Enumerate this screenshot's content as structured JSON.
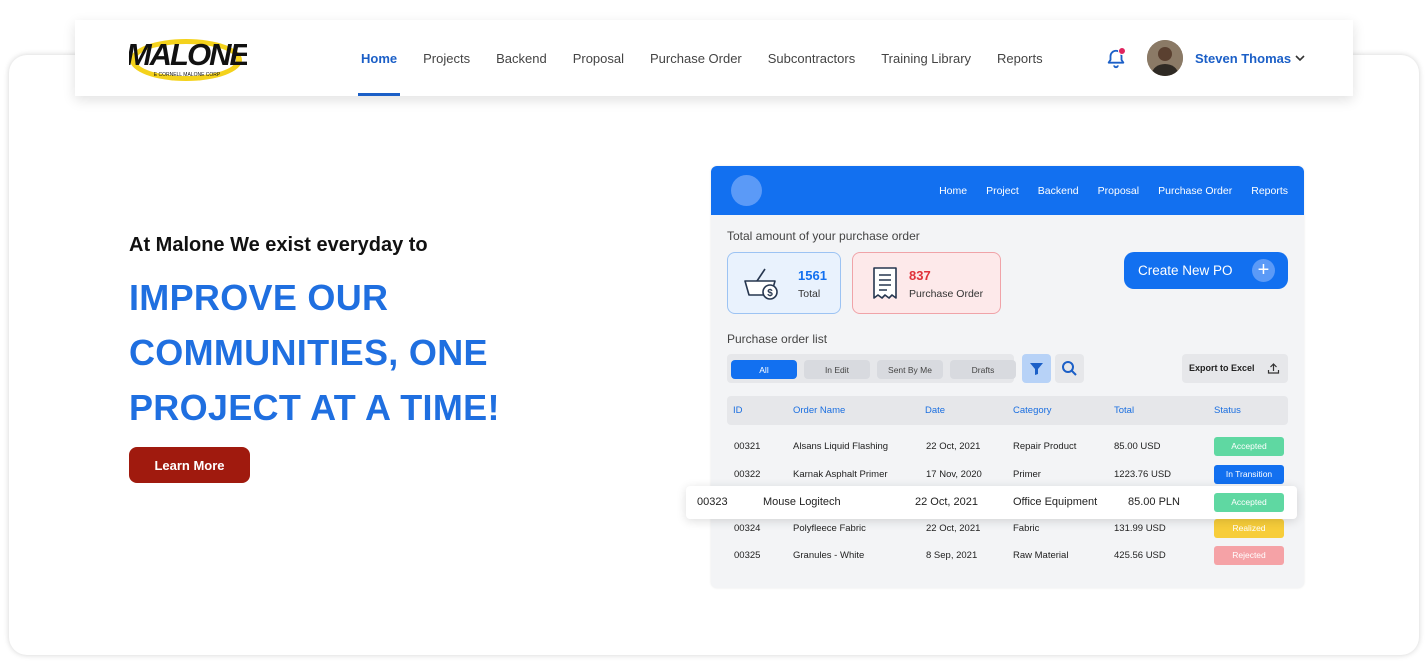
{
  "brand": {
    "logo_text": "MALONE",
    "logo_subtext": "E CORNELL MALONE CORP"
  },
  "nav": {
    "items": [
      {
        "label": "Home",
        "active": true
      },
      {
        "label": "Projects"
      },
      {
        "label": "Backend"
      },
      {
        "label": "Proposal"
      },
      {
        "label": "Purchase Order"
      },
      {
        "label": "Subcontractors"
      },
      {
        "label": "Training Library"
      },
      {
        "label": "Reports"
      }
    ]
  },
  "user": {
    "name": "Steven Thomas"
  },
  "hero": {
    "tagline": "At Malone We exist everyday to",
    "headline_lines": [
      "IMPROVE OUR",
      "COMMUNITIES, ONE",
      "PROJECT AT A TIME!"
    ],
    "cta_label": "Learn More"
  },
  "mockup": {
    "nav": [
      "Home",
      "Project",
      "Backend",
      "Proposal",
      "Purchase Order",
      "Reports"
    ],
    "summary_label": "Total amount of your purchase order",
    "stats": {
      "total": {
        "value": "1561",
        "label": "Total"
      },
      "purchase_order": {
        "value": "837",
        "label": "Purchase Order"
      }
    },
    "create_label": "Create New PO",
    "list_label": "Purchase order list",
    "filters": [
      "All",
      "In Edit",
      "Sent By Me",
      "Drafts"
    ],
    "export_label": "Export to Excel",
    "columns": [
      "ID",
      "Order Name",
      "Date",
      "Category",
      "Total",
      "Status"
    ],
    "rows": [
      {
        "id": "00321",
        "name": "Alsans Liquid Flashing",
        "date": "22 Oct, 2021",
        "category": "Repair Product",
        "total": "85.00 USD",
        "status": "Accepted"
      },
      {
        "id": "00322",
        "name": "Karnak Asphalt Primer",
        "date": "17 Nov, 2020",
        "category": "Primer",
        "total": "1223.76 USD",
        "status": "In Transition"
      },
      {
        "id": "00323",
        "name": "Mouse Logitech",
        "date": "22 Oct, 2021",
        "category": "Office Equipment",
        "total": "85.00 PLN",
        "status": "Accepted"
      },
      {
        "id": "00324",
        "name": "Polyfleece Fabric",
        "date": "22 Oct, 2021",
        "category": "Fabric",
        "total": "131.99 USD",
        "status": "Realized"
      },
      {
        "id": "00325",
        "name": "Granules - White",
        "date": "8 Sep, 2021",
        "category": "Raw Material",
        "total": "425.56 USD",
        "status": "Rejected"
      }
    ]
  },
  "colors": {
    "primary": "#1270f0",
    "nav_active": "#1b5fc7",
    "headline": "#1f6fe0",
    "cta": "#a01a0e",
    "accepted": "#5fd8a2",
    "in_transition": "#1270f0",
    "realized": "#f7cd3a",
    "rejected": "#f5a2a6"
  },
  "icons": [
    "bell-icon",
    "chevron-down-icon",
    "basket-money-icon",
    "receipt-icon",
    "plus-icon",
    "filter-icon",
    "search-icon",
    "upload-icon"
  ]
}
